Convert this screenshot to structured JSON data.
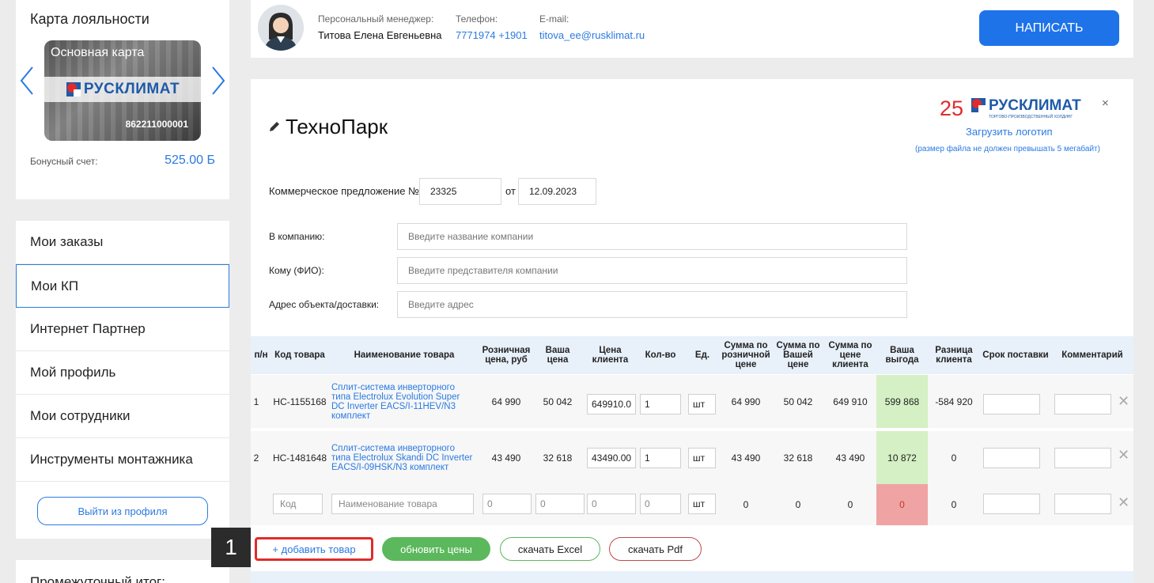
{
  "loyalty": {
    "title": "Карта лояльности",
    "card_name": "Основная карта",
    "brand": "РУСКЛИМАТ",
    "card_number": "862211000001",
    "bonus_label": "Бонусный счет:",
    "bonus_value": "525.00 Б"
  },
  "menu": {
    "items": [
      {
        "label": "Мои заказы"
      },
      {
        "label": "Мои КП"
      },
      {
        "label": "Интернет Партнер"
      },
      {
        "label": "Мой профиль"
      },
      {
        "label": "Мои сотрудники"
      },
      {
        "label": "Инструменты монтажника"
      }
    ],
    "logout": "Выйти из профиля"
  },
  "subtotal": {
    "title": "Промежуточный итог:"
  },
  "manager": {
    "manager_label": "Персональный менеджер:",
    "manager_name": "Титова Елена Евгеньевна",
    "phone_label": "Телефон:",
    "phone": "7771974 +1901",
    "email_label": "E-mail:",
    "email": "titova_ee@rusklimat.ru",
    "write_button": "НАПИСАТЬ"
  },
  "main": {
    "company": "ТехноПарк",
    "brand_years": "25",
    "brand_name": "РУСКЛИМАТ",
    "brand_sub": "ТОРГОВО-ПРОИЗВОДСТВЕННЫЙ ХОЛДИНГ",
    "close": "×",
    "upload_logo": "Загрузить логотип",
    "upload_note": "(размер файла не должен превышать 5 мегабайт)",
    "kp_label": "Коммерческое предложение №",
    "kp_number": "23325",
    "from_label": "от",
    "kp_date": "12.09.2023",
    "company_label": "В компанию:",
    "company_placeholder": "Введите название компании",
    "to_label": "Кому (ФИО):",
    "to_placeholder": "Введите представителя компании",
    "address_label": "Адрес объекта/доставки:",
    "address_placeholder": "Введите адрес"
  },
  "table": {
    "headers": {
      "num": "п/н",
      "code": "Код товара",
      "name": "Наименование товара",
      "retail": "Розничная цена, руб",
      "your_price": "Ваша цена",
      "client_price": "Цена клиента",
      "qty": "Кол-во",
      "unit": "Ед.",
      "sum_retail": "Сумма по розничной цене",
      "sum_your": "Сумма по Вашей цене",
      "sum_client": "Сумма по цене клиента",
      "benefit": "Ваша выгода",
      "diff": "Разница клиента",
      "delivery": "Срок поставки",
      "comment": "Комментарий"
    },
    "rows": [
      {
        "num": "1",
        "code": "НС-1155168",
        "name": "Сплит-система инверторного типа Electrolux Evolution Super DC Inverter EACS/I-11HEV/N3 комплект",
        "retail": "64 990",
        "your_price": "50 042",
        "client_price": "649910.0",
        "qty": "1",
        "unit": "шт",
        "sum_retail": "64 990",
        "sum_your": "50 042",
        "sum_client": "649 910",
        "benefit": "599 868",
        "diff": "-584 920"
      },
      {
        "num": "2",
        "code": "НС-1481648",
        "name": "Сплит-система инверторного типа Electrolux Skandi DC Inverter EACS/I-09HSK/N3 комплект",
        "retail": "43 490",
        "your_price": "32 618",
        "client_price": "43490.00",
        "qty": "1",
        "unit": "шт",
        "sum_retail": "43 490",
        "sum_your": "32 618",
        "sum_client": "43 490",
        "benefit": "10 872",
        "diff": "0"
      }
    ],
    "new_row": {
      "code_placeholder": "Код",
      "name_placeholder": "Наименование товара",
      "retail": "0",
      "your_price": "0",
      "client_price": "0",
      "qty": "0",
      "unit": "шт",
      "sum_retail": "0",
      "sum_your": "0",
      "sum_client": "0",
      "benefit": "0",
      "diff": "0"
    },
    "delete": "✕"
  },
  "actions": {
    "add": "+ добавить товар",
    "refresh": "обновить цены",
    "excel": "скачать Excel",
    "pdf": "скачать Pdf"
  },
  "step_badge": "1",
  "colors": {
    "accent": "#2a7ae2",
    "green": "#5cb85c",
    "benefit_positive": "#d4f0c4",
    "benefit_zero": "#f0a3a3",
    "highlight": "#e02b2b"
  }
}
